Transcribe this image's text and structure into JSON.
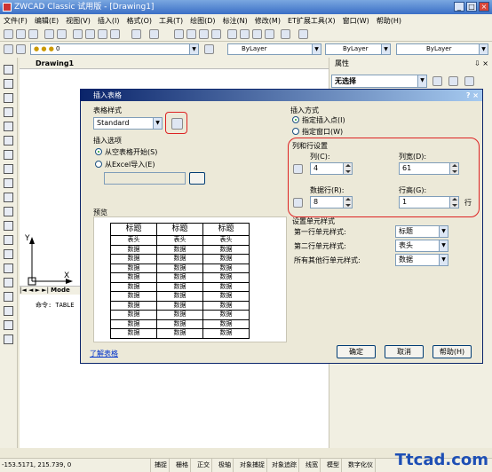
{
  "app": {
    "title": "ZWCAD Classic 试用版 - [Drawing1]"
  },
  "menu": [
    "文件(F)",
    "编辑(E)",
    "视图(V)",
    "插入(I)",
    "格式(O)",
    "工具(T)",
    "绘图(D)",
    "标注(N)",
    "修改(M)",
    "ET扩展工具(X)",
    "窗口(W)",
    "帮助(H)"
  ],
  "layers": {
    "layer_value": "0",
    "color_value": "ByLayer",
    "linetype_value": "ByLayer",
    "lineweight_value": "ByLayer"
  },
  "drawing_tab": "Drawing1",
  "layout_tab": "Mode",
  "command_line": "命令: TABLE",
  "properties": {
    "title": "属性",
    "selection": "无选择"
  },
  "dialog": {
    "title": "插入表格",
    "table_style_label": "表格样式",
    "table_style_value": "Standard",
    "insert_options_label": "插入选项",
    "opt_empty": "从空表格开始(S)",
    "opt_excel": "从Excel导入(E)",
    "preview_label": "预览",
    "insert_method_label": "插入方式",
    "method_point": "指定插入点(I)",
    "method_window": "指定窗口(W)",
    "rows_cols_label": "列和行设置",
    "cols_label": "列(C):",
    "cols_value": "4",
    "col_width_label": "列宽(D):",
    "col_width_value": "61",
    "data_rows_label": "数据行(R):",
    "data_rows_value": "8",
    "row_height_label": "行高(G):",
    "row_height_value": "1",
    "row_unit": "行",
    "cell_style_label": "设置单元样式",
    "first_row_label": "第一行单元样式:",
    "first_row_value": "标题",
    "second_row_label": "第二行单元样式:",
    "second_row_value": "表头",
    "other_rows_label": "所有其他行单元样式:",
    "other_rows_value": "数据",
    "learn_link": "了解表格",
    "ok": "确定",
    "cancel": "取消",
    "help": "帮助(H)"
  },
  "preview": {
    "header": [
      "标题",
      "标题",
      "标题"
    ],
    "subheader": [
      "表头",
      "表头",
      "表头"
    ],
    "data_cell": "数据",
    "data_rows": 10
  },
  "status": {
    "coords": "-153.5171, 215.739, 0",
    "buttons": [
      "捕捉",
      "栅格",
      "正交",
      "极轴",
      "对象捕捉",
      "对象追踪",
      "线宽",
      "模型",
      "数字化仪"
    ]
  },
  "watermark": "Ttcad.com"
}
